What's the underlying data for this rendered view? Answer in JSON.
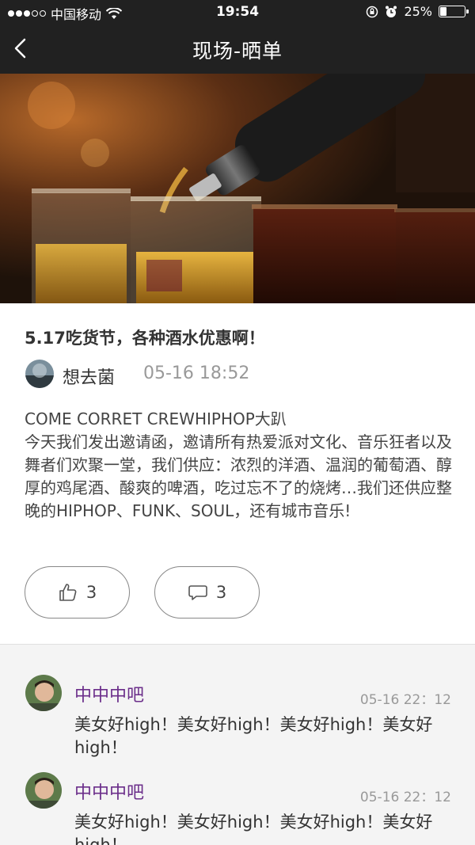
{
  "status_bar": {
    "carrier": "中国移动",
    "time": "19:54",
    "battery_percent": "25%",
    "battery_level": 0.25
  },
  "nav": {
    "title": "现场-晒单",
    "back_icon": "chevron-left-icon"
  },
  "post": {
    "title": "5.17吃货节，各种酒水优惠啊！",
    "author": "想去菌",
    "time": "05-16 18:52",
    "body": "COME CORRET CREWHIPHOP大趴\n今天我们发出邀请函，邀请所有热爱派对文化、音乐狂者以及舞者们欢聚一堂，我们供应：浓烈的洋酒、温润的葡萄酒、醇厚的鸡尾酒、酸爽的啤酒，吃过忘不了的烧烤…我们还供应整晚的HIPHOP、FUNK、SOUL，还有城市音乐!",
    "likes": "3",
    "comments": "3"
  },
  "comments": [
    {
      "name": "中中中吧",
      "time": "05-16 22：12",
      "text": "美女好high！美女好high！美女好high！美女好high！"
    },
    {
      "name": "中中中吧",
      "time": "05-16 22：12",
      "text": "美女好high！美女好high！美女好high！美女好high！"
    }
  ],
  "colors": {
    "bar_bg": "#212121",
    "comment_name": "#6b2e8a",
    "page_bg": "#f4f4f4"
  }
}
